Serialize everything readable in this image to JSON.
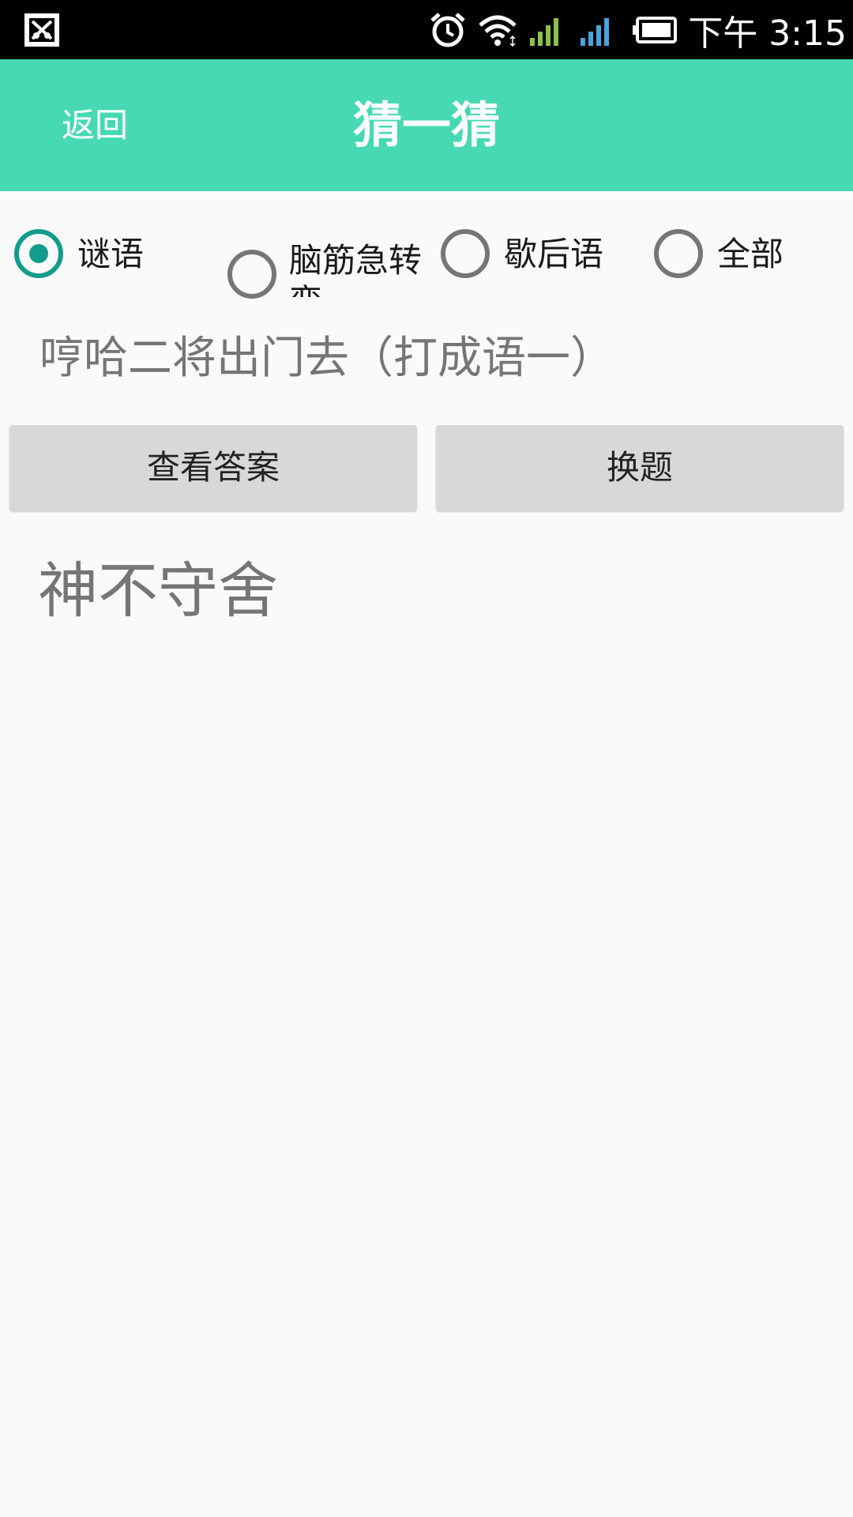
{
  "status_bar": {
    "time": "下午 3:15",
    "icons": [
      "app-notification-icon",
      "alarm-icon",
      "wifi-icon",
      "signal-icon",
      "signal-icon",
      "battery-icon"
    ],
    "colors": {
      "signal_1": "#8bc34a",
      "signal_2": "#4aa3df"
    }
  },
  "app_bar": {
    "back_label": "返回",
    "title": "猜一猜",
    "color": "#46d9b3"
  },
  "categories": {
    "options": [
      {
        "label": "谜语",
        "checked": true
      },
      {
        "label": "脑筋急转弯",
        "checked": false
      },
      {
        "label": "歇后语",
        "checked": false
      },
      {
        "label": "全部",
        "checked": false
      }
    ],
    "accent": "#139c8c"
  },
  "question": "哼哈二将出门去（打成语一）",
  "buttons": {
    "show_answer": "查看答案",
    "next_question": "换题"
  },
  "answer": "神不守舍"
}
